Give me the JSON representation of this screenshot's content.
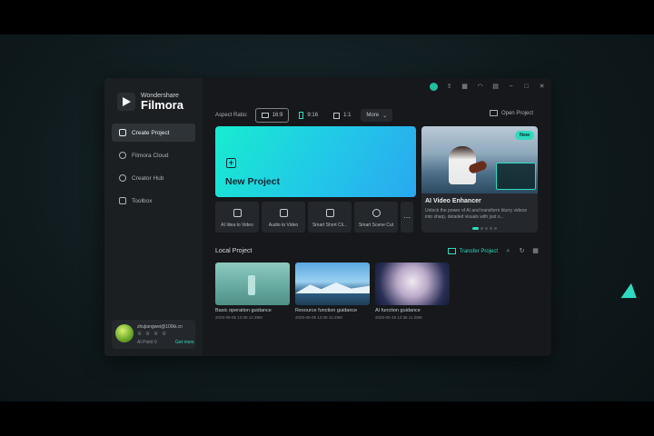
{
  "app": {
    "brand_top": "Wondershare",
    "brand_name": "Filmora"
  },
  "sidebar": {
    "items": [
      {
        "label": "Create Project",
        "active": true,
        "icon": "folder-plus-icon"
      },
      {
        "label": "Filmora Cloud",
        "active": false,
        "icon": "cloud-icon"
      },
      {
        "label": "Creator Hub",
        "active": false,
        "icon": "bulb-icon"
      },
      {
        "label": "Toolbox",
        "active": false,
        "icon": "toolbox-icon"
      }
    ]
  },
  "account": {
    "email": "zhujiangwei@100ki.cn",
    "icons": "♕ ♕ ♕ ♕",
    "credits": "AI Point 0",
    "get_more": "Get more"
  },
  "header": {
    "aspect_label": "Aspect Ratio:",
    "ratios": [
      "16:9",
      "9:16",
      "1:1"
    ],
    "more_label": "More",
    "open_project": "Open Project"
  },
  "new_project": {
    "label": "New Project"
  },
  "feature": {
    "badge": "New",
    "title": "AI Video Enhancer",
    "description": "Unlock the power of AI and transform blurry videos into sharp, detailed visuals with just o..."
  },
  "tools": [
    {
      "label": "AI Idea to Video"
    },
    {
      "label": "Audio to Video"
    },
    {
      "label": "Smart Short Cli..."
    },
    {
      "label": "Smart Scene Cut"
    }
  ],
  "tools_more": "⋯",
  "local": {
    "title": "Local Project",
    "transfer": "Transfer Project",
    "projects": [
      {
        "name": "Basic operation guidance",
        "meta": "2025-06-05 12:09  12.38M"
      },
      {
        "name": "Resource function guidance",
        "meta": "2025-06-05 12:09  12.29M"
      },
      {
        "name": "AI function guidance",
        "meta": "2025-05-19 12:36  11.28M"
      }
    ]
  },
  "colors": {
    "accent": "#2ddbc0",
    "window_bg": "#1c1f22"
  }
}
